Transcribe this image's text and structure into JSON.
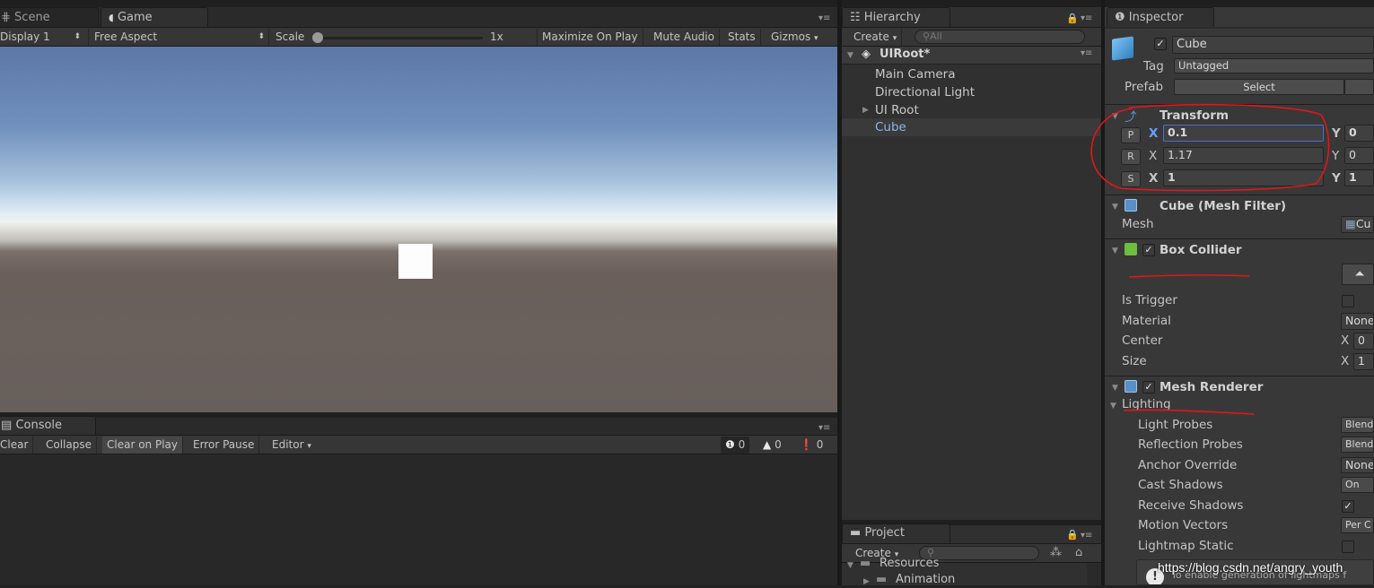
{
  "game_panel": {
    "tabs": [
      {
        "label": "Scene"
      },
      {
        "label": "Game"
      }
    ],
    "toolbar": {
      "display": "Display 1",
      "aspect": "Free Aspect",
      "scale_label": "Scale",
      "scale_value": "1x",
      "maximize": "Maximize On Play",
      "mute": "Mute Audio",
      "stats": "Stats",
      "gizmos": "Gizmos"
    }
  },
  "console": {
    "tab": "Console",
    "buttons": {
      "clear": "Clear",
      "collapse": "Collapse",
      "clear_on_play": "Clear on Play",
      "error_pause": "Error Pause",
      "editor": "Editor"
    },
    "counts": {
      "info": "0",
      "warn": "0",
      "error": "0"
    }
  },
  "hierarchy": {
    "tab": "Hierarchy",
    "create": "Create",
    "search_placeholder": "All",
    "scene": "UIRoot*",
    "items": [
      {
        "label": "Main Camera"
      },
      {
        "label": "Directional Light"
      },
      {
        "label": "UI Root"
      },
      {
        "label": "Cube"
      }
    ]
  },
  "project": {
    "tab": "Project",
    "create": "Create",
    "items": [
      {
        "label": "Resources"
      },
      {
        "label": "Animation"
      }
    ]
  },
  "inspector": {
    "tab": "Inspector",
    "object_name": "Cube",
    "tag_label": "Tag",
    "tag_value": "Untagged",
    "prefab_label": "Prefab",
    "prefab_select": "Select",
    "transform": {
      "title": "Transform",
      "position": {
        "btn": "P",
        "x": "0.1",
        "y": "0"
      },
      "rotation": {
        "btn": "R",
        "x": "1.17",
        "y": "0"
      },
      "scale": {
        "btn": "S",
        "x": "1",
        "y": "1"
      }
    },
    "mesh_filter": {
      "title": "Cube (Mesh Filter)",
      "mesh_label": "Mesh",
      "mesh_value": "Cu"
    },
    "box_collider": {
      "title": "Box Collider",
      "is_trigger": "Is Trigger",
      "material": "Material",
      "material_value": "None",
      "center": "Center",
      "center_x": "0",
      "size": "Size",
      "size_x": "1"
    },
    "mesh_renderer": {
      "title": "Mesh Renderer",
      "lighting": "Lighting",
      "rows": [
        {
          "label": "Light Probes",
          "value": "Blend"
        },
        {
          "label": "Reflection Probes",
          "value": "Blend"
        },
        {
          "label": "Anchor Override",
          "value": "None"
        },
        {
          "label": "Cast Shadows",
          "value": "On"
        },
        {
          "label": "Receive Shadows",
          "value": "✓"
        },
        {
          "label": "Motion Vectors",
          "value": "Per C"
        },
        {
          "label": "Lightmap Static",
          "value": ""
        }
      ],
      "info": "To enable generation of lightmaps f"
    }
  },
  "watermark": "https://blog.csdn.net/angry_youth",
  "colors": {
    "annotation": "#e0161b",
    "selection": "#3e5f96",
    "panel": "#383838"
  }
}
